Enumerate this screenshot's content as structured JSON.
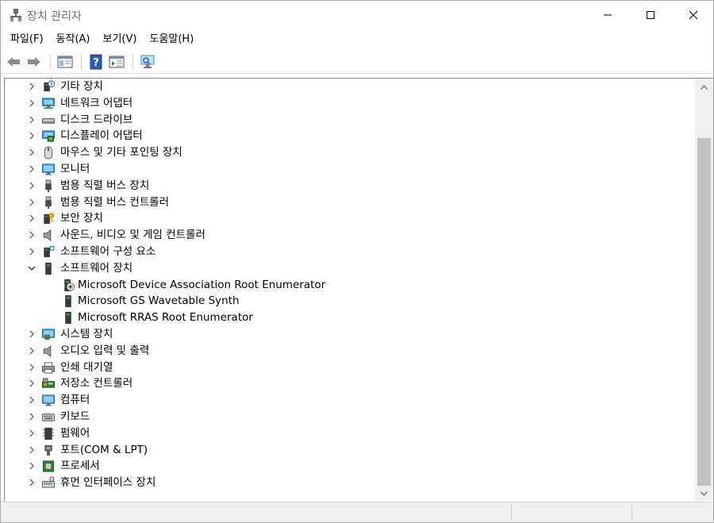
{
  "window": {
    "title": "장치 관리자"
  },
  "menu": [
    {
      "label": "파일(F)"
    },
    {
      "label": "동작(A)"
    },
    {
      "label": "보기(V)"
    },
    {
      "label": "도움말(H)"
    }
  ],
  "toolbar": {
    "back": "back-arrow-icon",
    "forward": "forward-arrow-icon",
    "show_hide": "console-tree-icon",
    "help": "help-icon",
    "properties": "properties-icon",
    "scan": "scan-hardware-icon"
  },
  "tree": [
    {
      "label": "기타 장치",
      "icon": "unknown-device-icon",
      "expanded": false
    },
    {
      "label": "네트워크 어댑터",
      "icon": "network-adapter-icon",
      "expanded": false
    },
    {
      "label": "디스크 드라이브",
      "icon": "disk-drive-icon",
      "expanded": false
    },
    {
      "label": "디스플레이 어댑터",
      "icon": "display-adapter-icon",
      "expanded": false
    },
    {
      "label": "마우스 및 기타 포인팅 장치",
      "icon": "mouse-icon",
      "expanded": false
    },
    {
      "label": "모니터",
      "icon": "monitor-icon",
      "expanded": false
    },
    {
      "label": "범용 직렬 버스 장치",
      "icon": "usb-icon",
      "expanded": false
    },
    {
      "label": "범용 직렬 버스 컨트롤러",
      "icon": "usb-controller-icon",
      "expanded": false
    },
    {
      "label": "보안 장치",
      "icon": "security-device-icon",
      "expanded": false
    },
    {
      "label": "사운드, 비디오 및 게임 컨트롤러",
      "icon": "speaker-icon",
      "expanded": false
    },
    {
      "label": "소프트웨어 구성 요소",
      "icon": "software-component-icon",
      "expanded": false
    },
    {
      "label": "소프트웨어 장치",
      "icon": "software-device-icon",
      "expanded": true
    },
    {
      "label": "Microsoft Device Association Root Enumerator",
      "icon": "device-warning-icon",
      "child": true
    },
    {
      "label": "Microsoft GS Wavetable Synth",
      "icon": "software-device-icon",
      "child": true
    },
    {
      "label": "Microsoft RRAS Root Enumerator",
      "icon": "software-device-icon",
      "child": true
    },
    {
      "label": "시스템 장치",
      "icon": "system-device-icon",
      "expanded": false
    },
    {
      "label": "오디오 입력 및 출력",
      "icon": "audio-icon",
      "expanded": false
    },
    {
      "label": "인쇄 대기열",
      "icon": "printer-icon",
      "expanded": false
    },
    {
      "label": "저장소 컨트롤러",
      "icon": "storage-controller-icon",
      "expanded": false
    },
    {
      "label": "컴퓨터",
      "icon": "computer-icon",
      "expanded": false
    },
    {
      "label": "키보드",
      "icon": "keyboard-icon",
      "expanded": false
    },
    {
      "label": "펌웨어",
      "icon": "firmware-icon",
      "expanded": false
    },
    {
      "label": "포트(COM & LPT)",
      "icon": "port-icon",
      "expanded": false
    },
    {
      "label": "프로세서",
      "icon": "processor-icon",
      "expanded": false
    },
    {
      "label": "휴먼 인터페이스 장치",
      "icon": "hid-icon",
      "expanded": false
    }
  ],
  "colors": {
    "monitor": "#3b8fd6",
    "accent": "#0078d7",
    "gray": "#5a5a5a"
  }
}
